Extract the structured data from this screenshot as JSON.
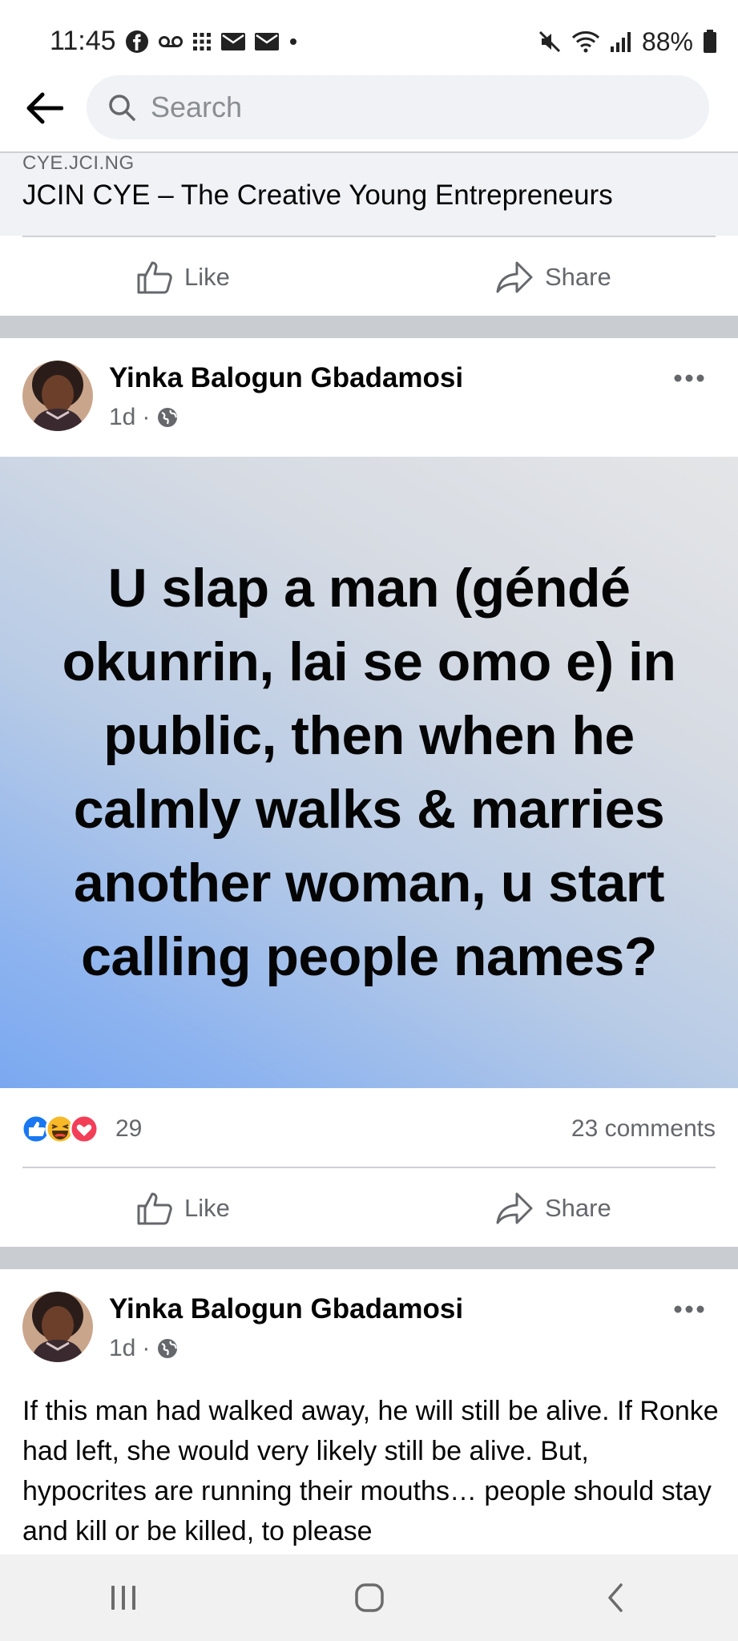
{
  "status_bar": {
    "time": "11:45",
    "battery": "88%",
    "left_icons": [
      "facebook-icon",
      "voicemail-icon",
      "grid-icon",
      "mail-icon",
      "mail-icon",
      "dot-icon"
    ],
    "right_icons": [
      "mute-icon",
      "wifi-icon",
      "signal-icon",
      "battery-icon"
    ]
  },
  "header": {
    "search_placeholder": "Search"
  },
  "link_preview": {
    "domain": "CYE.JCI.NG",
    "title": "JCIN CYE – The Creative Young Entrepreneurs"
  },
  "actions": {
    "like_label": "Like",
    "share_label": "Share"
  },
  "posts": [
    {
      "author": "Yinka Balogun Gbadamosi",
      "time": "1d",
      "separator": "·",
      "banner_text": "U slap a man (géndé okunrin, lai se omo e) in public, then when he calmly walks & marries another woman, u start calling people names?",
      "reaction_count": "29",
      "comments": "23 comments"
    },
    {
      "author": "Yinka Balogun Gbadamosi",
      "time": "1d",
      "separator": "·",
      "body": "If this man had walked away, he will still be alive. If Ronke had left, she would very likely still be alive. But, hypocrites are running their mouths… people should stay and kill or be killed, to please"
    }
  ],
  "colors": {
    "accent_blue": "#1877f2",
    "text_primary": "#050505",
    "text_secondary": "#65676b",
    "separator_gray": "#c9ccd1"
  }
}
